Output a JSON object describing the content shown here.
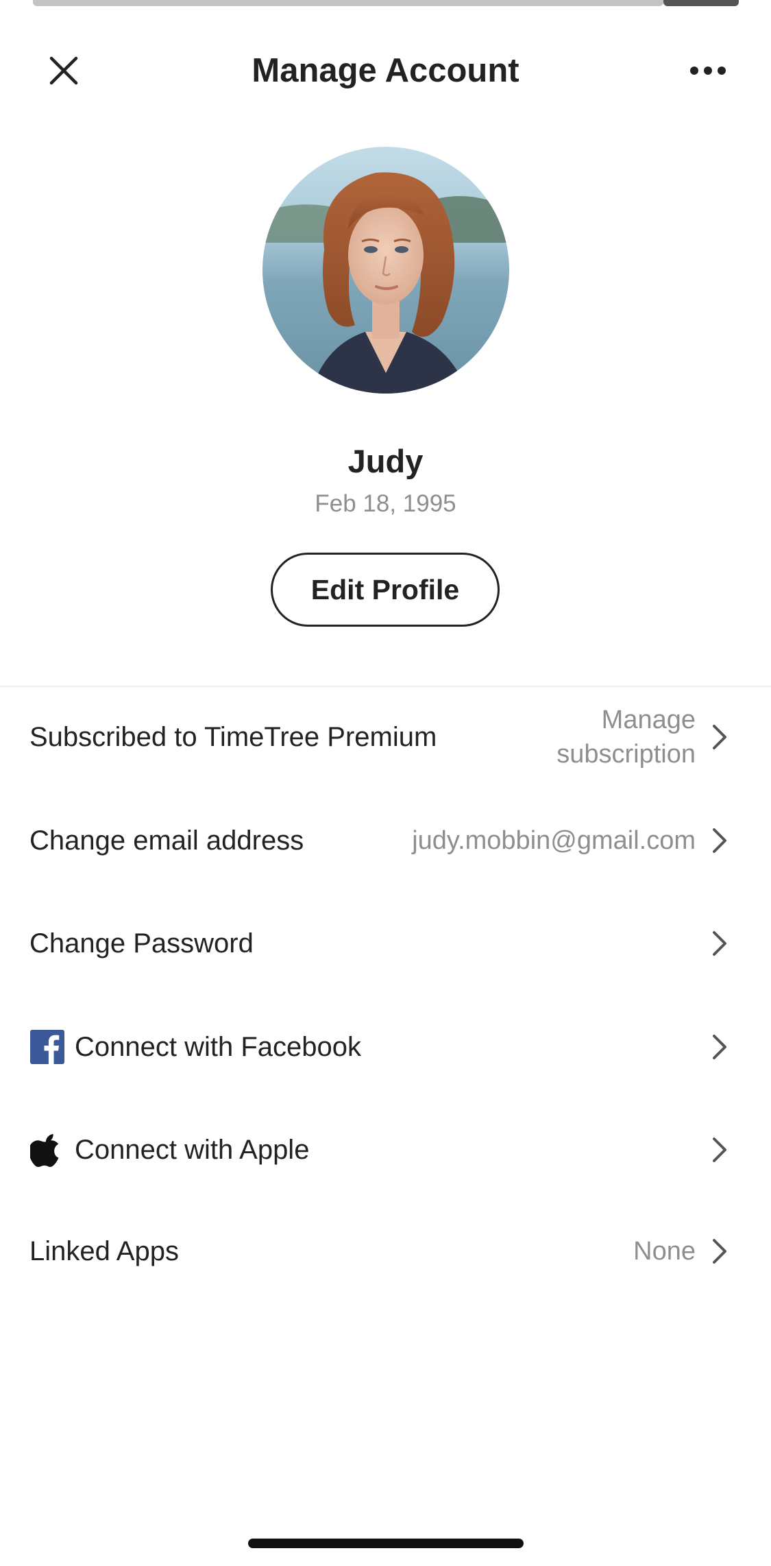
{
  "header": {
    "title": "Manage Account",
    "close_icon": "close-icon",
    "more_icon": "more-horizontal-icon"
  },
  "profile": {
    "name": "Judy",
    "birthday": "Feb 18, 1995",
    "edit_button_label": "Edit Profile"
  },
  "settings": {
    "subscription": {
      "label": "Subscribed to TimeTree Premium",
      "value_line1": "Manage",
      "value_line2": "subscription"
    },
    "email": {
      "label": "Change email address",
      "value": "judy.mobbin@gmail.com"
    },
    "password": {
      "label": "Change Password"
    },
    "facebook": {
      "label": "Connect with Facebook",
      "icon": "facebook-icon",
      "icon_color": "#3b5998"
    },
    "apple": {
      "label": "Connect with Apple",
      "icon": "apple-icon"
    },
    "linked_apps": {
      "label": "Linked Apps",
      "value": "None"
    }
  },
  "colors": {
    "text_primary": "#222222",
    "text_secondary": "#8e8e8e",
    "chevron": "#555555"
  }
}
